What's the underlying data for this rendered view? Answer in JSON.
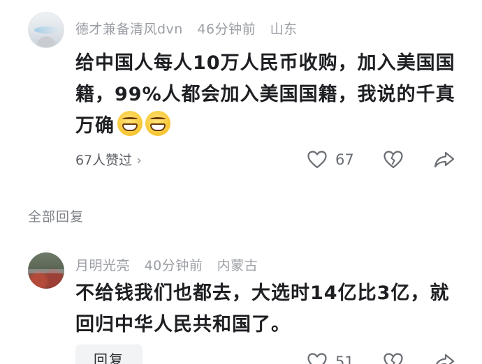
{
  "comment": {
    "author": "德才兼备清风dvn",
    "time": "46分钟前",
    "location": "山东",
    "text": "给中国人每人10万人民币收购，加入美国国籍，99%人都会加入美国国籍，我说的千真万确",
    "emoji_icon": "grinning-face-icon",
    "likers_label": "67人赞过",
    "like_count": "67"
  },
  "section": {
    "title": "全部回复"
  },
  "reply": {
    "author": "月明光亮",
    "time": "40分钟前",
    "location": "内蒙古",
    "text": "不给钱我们也都去，大选时14亿比3亿，就回归中华人民共和国了。",
    "reply_button_label": "回复",
    "like_count": "51"
  },
  "colors": {
    "text": "#1d1f22",
    "meta": "#9a9ea4",
    "icon": "#6a6e74"
  }
}
